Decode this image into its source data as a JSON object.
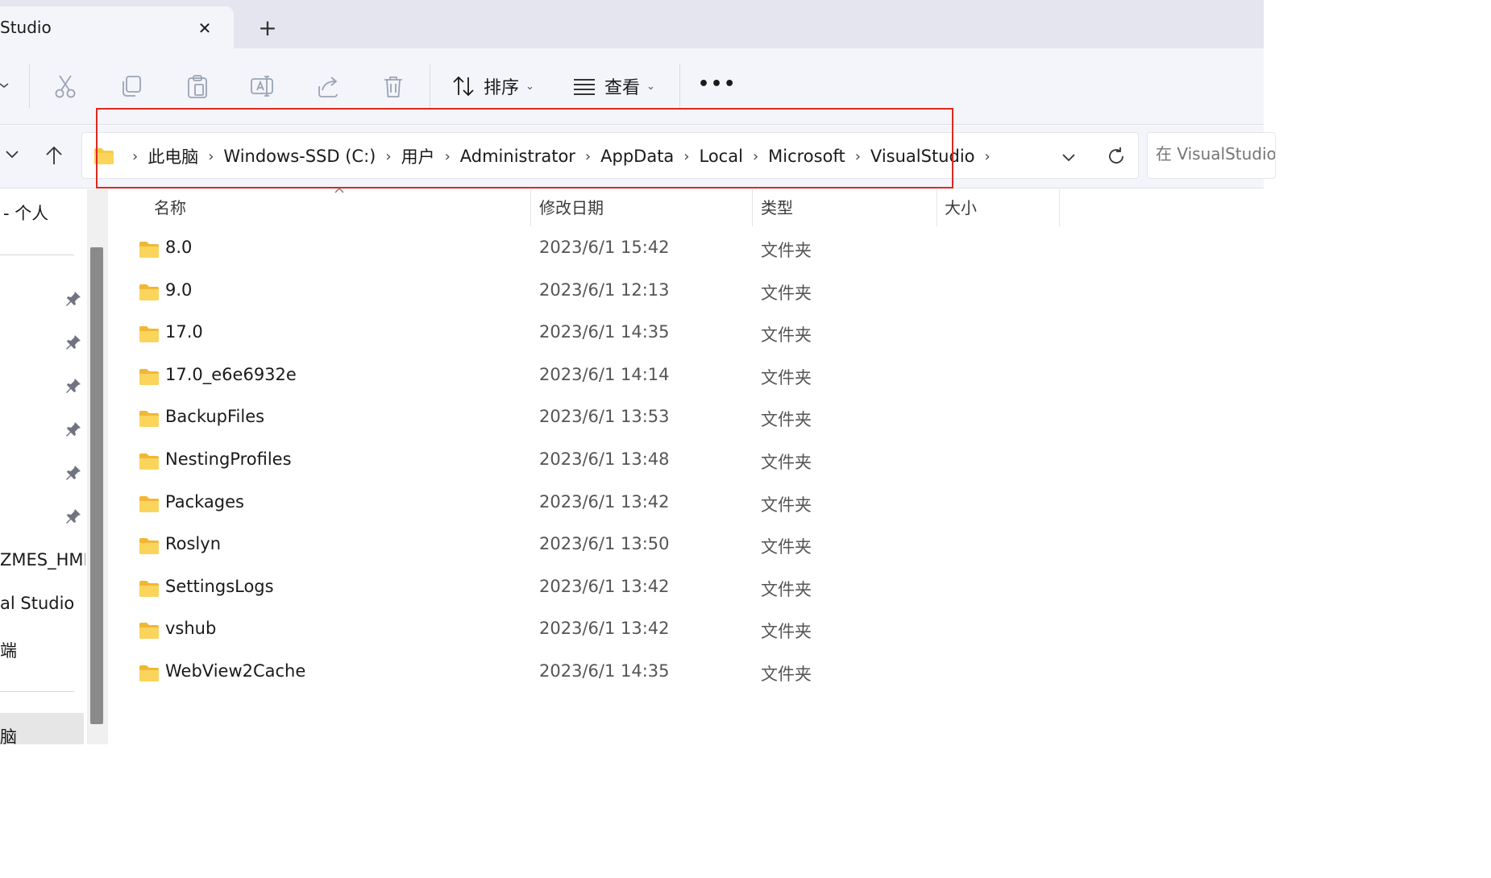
{
  "window": {
    "tab_title": "Studio",
    "new_tab_symbol": "+",
    "close_symbol": "✕"
  },
  "toolbar": {
    "actions": [
      "cut-icon",
      "copy-icon",
      "paste-icon",
      "rename-icon",
      "share-icon",
      "delete-icon"
    ],
    "sort_label": "排序",
    "view_label": "查看",
    "more_label": "•••",
    "caret": "⌄"
  },
  "address": {
    "crumbs": [
      "此电脑",
      "Windows-SSD (C:)",
      "用户",
      "Administrator",
      "AppData",
      "Local",
      "Microsoft",
      "VisualStudio"
    ],
    "separator": "›",
    "highlight_color": "#e0281e"
  },
  "search": {
    "placeholder": "在 VisualStudio 中搜索"
  },
  "sidebar": {
    "top_label": "- 个人",
    "pinned_count": 6,
    "items": [
      "ZMES_HMI",
      "al Studio",
      "端"
    ],
    "selected_label": "脑"
  },
  "columns": {
    "name": "名称",
    "date": "修改日期",
    "type": "类型",
    "size": "大小"
  },
  "files": [
    {
      "name": "8.0",
      "date": "2023/6/1 15:42",
      "type": "文件夹"
    },
    {
      "name": "9.0",
      "date": "2023/6/1 12:13",
      "type": "文件夹"
    },
    {
      "name": "17.0",
      "date": "2023/6/1 14:35",
      "type": "文件夹"
    },
    {
      "name": "17.0_e6e6932e",
      "date": "2023/6/1 14:14",
      "type": "文件夹"
    },
    {
      "name": "BackupFiles",
      "date": "2023/6/1 13:53",
      "type": "文件夹"
    },
    {
      "name": "NestingProfiles",
      "date": "2023/6/1 13:48",
      "type": "文件夹"
    },
    {
      "name": "Packages",
      "date": "2023/6/1 13:42",
      "type": "文件夹"
    },
    {
      "name": "Roslyn",
      "date": "2023/6/1 13:50",
      "type": "文件夹"
    },
    {
      "name": "SettingsLogs",
      "date": "2023/6/1 13:42",
      "type": "文件夹"
    },
    {
      "name": "vshub",
      "date": "2023/6/1 13:42",
      "type": "文件夹"
    },
    {
      "name": "WebView2Cache",
      "date": "2023/6/1 14:35",
      "type": "文件夹"
    }
  ],
  "colors": {
    "folder_yellow": "#f8c944",
    "folder_dark": "#e0a82a"
  }
}
